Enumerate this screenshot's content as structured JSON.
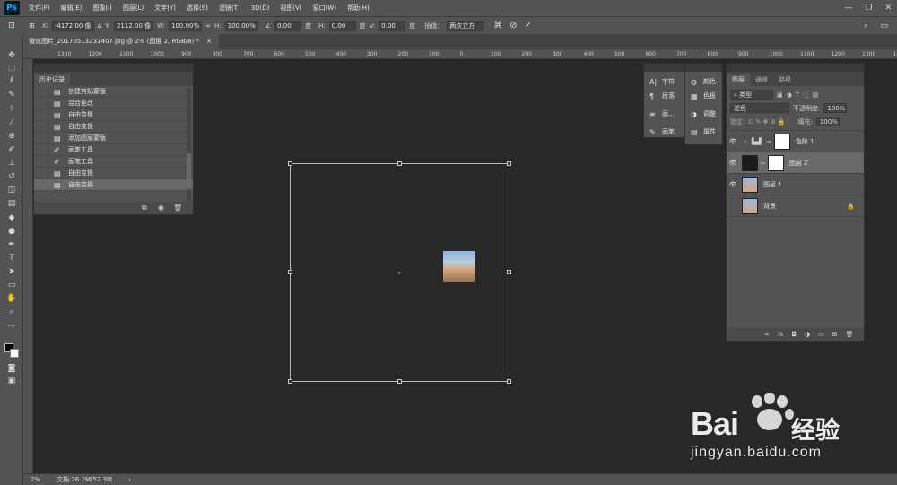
{
  "app": {
    "logo": "Ps"
  },
  "menu": [
    "文件(F)",
    "编辑(E)",
    "图像(I)",
    "图层(L)",
    "文字(Y)",
    "选择(S)",
    "滤镜(T)",
    "3D(D)",
    "视图(V)",
    "窗口(W)",
    "帮助(H)"
  ],
  "options": {
    "x_label": "X:",
    "x_value": "-4172.00 像",
    "y_label": "Y:",
    "y_value": "2112.00 像",
    "w_label": "W:",
    "w_value": "100.00%",
    "h_label": "H:",
    "h_value": "100.00%",
    "angle_value": "0.00",
    "angle_unit": "度",
    "hskew_label": "H:",
    "hskew_value": "0.00",
    "hskew_unit": "度",
    "vskew_label": "V:",
    "vskew_value": "0.00",
    "vskew_unit": "度",
    "interp_label": "插值：",
    "interp_value": "两次立方"
  },
  "document": {
    "tab_title": "微信图片_20170513231407.jpg @ 2% (图层 2, RGB/8) *"
  },
  "rulers": {
    "top": [
      "1300",
      "1200",
      "1100",
      "1000",
      "900",
      "800",
      "700",
      "600",
      "500",
      "400",
      "300",
      "200",
      "100",
      "0",
      "100",
      "200",
      "300",
      "400",
      "500",
      "600",
      "700",
      "800",
      "900",
      "1000",
      "1100",
      "1200",
      "1300",
      "1400"
    ]
  },
  "history": {
    "tab": "历史记录",
    "items": [
      {
        "label": "创建剪贴蒙版",
        "icon": "doc"
      },
      {
        "label": "混合更改",
        "icon": "doc"
      },
      {
        "label": "自由变换",
        "icon": "doc"
      },
      {
        "label": "自由变换",
        "icon": "doc"
      },
      {
        "label": "添加图层蒙版",
        "icon": "doc"
      },
      {
        "label": "画笔工具",
        "icon": "brush"
      },
      {
        "label": "画笔工具",
        "icon": "brush"
      },
      {
        "label": "自由变换",
        "icon": "doc"
      },
      {
        "label": "自由变换",
        "icon": "doc"
      }
    ]
  },
  "midpanel1": {
    "items": [
      {
        "label": "字符",
        "icon": "A|"
      },
      {
        "label": "段落",
        "icon": "¶"
      },
      {
        "label": "画...",
        "icon": "≡"
      },
      {
        "label": "画笔",
        "icon": "✎"
      }
    ]
  },
  "midpanel2": {
    "items": [
      {
        "label": "颜色",
        "icon": "◍"
      },
      {
        "label": "色板",
        "icon": "▦"
      },
      {
        "label": "调整",
        "icon": "◑"
      },
      {
        "label": "属性",
        "icon": "▤"
      }
    ]
  },
  "layers": {
    "tabs": [
      "图层",
      "通道",
      "路径"
    ],
    "filter_label": "类型",
    "blend_mode": "滤色",
    "opacity_label": "不透明度:",
    "opacity_value": "100%",
    "lock_label": "锁定:",
    "fill_label": "填充:",
    "fill_value": "100%",
    "items": [
      {
        "name": "色阶 1"
      },
      {
        "name": "图层 2"
      },
      {
        "name": "图层 1"
      },
      {
        "name": "背景"
      }
    ]
  },
  "status": {
    "zoom": "2%",
    "doc_info": "文档:26.2M/52.3M"
  },
  "watermark": {
    "brand": "Bai",
    "brand2": "经验",
    "url": "jingyan.baidu.com"
  }
}
